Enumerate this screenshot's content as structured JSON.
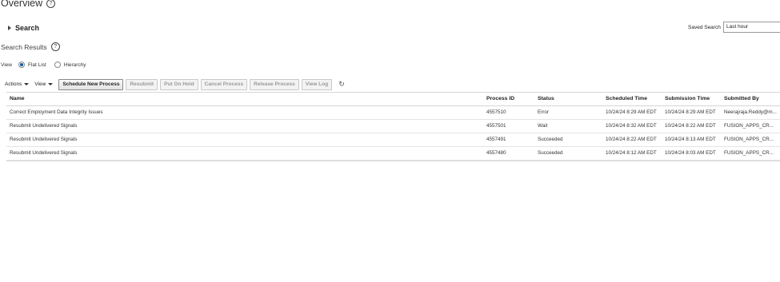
{
  "page": {
    "title": "Overview",
    "search_toggle": "Search",
    "saved_search_label": "Saved Search",
    "saved_search_value": "Last hour",
    "search_results_label": "Search Results",
    "help_glyph": "?"
  },
  "view": {
    "label": "View",
    "options": [
      "Flat List",
      "Hierarchy"
    ],
    "selected": "Flat List"
  },
  "toolbar": {
    "actions": "Actions",
    "view": "View",
    "schedule_new_process": "Schedule New Process",
    "resubmit": "Resubmit",
    "put_on_hold": "Put On Hold",
    "cancel_process": "Cancel Process",
    "release_process": "Release Process",
    "view_log": "View Log",
    "refresh_glyph": "↻"
  },
  "table": {
    "headers": {
      "name": "Name",
      "process_id": "Process ID",
      "status": "Status",
      "scheduled_time": "Scheduled Time",
      "submission_time": "Submission Time",
      "submitted_by": "Submitted By"
    },
    "rows": [
      {
        "name": "Correct Employment Data Integrity Issues",
        "process_id": "4557510",
        "status": "Error",
        "scheduled_time": "10/24/24 8:29 AM EDT",
        "submission_time": "10/24/24 8:29 AM EDT",
        "submitted_by": "Neerajraja.Reddy@m..."
      },
      {
        "name": "Resubmit Undelivered Signals",
        "process_id": "4557501",
        "status": "Wait",
        "scheduled_time": "10/24/24 8:32 AM EDT",
        "submission_time": "10/24/24 8:22 AM EDT",
        "submitted_by": "FUSION_APPS_CR..."
      },
      {
        "name": "Resubmit Undelivered Signals",
        "process_id": "4557491",
        "status": "Succeeded",
        "scheduled_time": "10/24/24 8:22 AM EDT",
        "submission_time": "10/24/24 8:13 AM EDT",
        "submitted_by": "FUSION_APPS_CR..."
      },
      {
        "name": "Resubmit Undelivered Signals",
        "process_id": "4557480",
        "status": "Succeeded",
        "scheduled_time": "10/24/24 8:12 AM EDT",
        "submission_time": "10/24/24 8:03 AM EDT",
        "submitted_by": "FUSION_APPS_CR..."
      }
    ]
  }
}
